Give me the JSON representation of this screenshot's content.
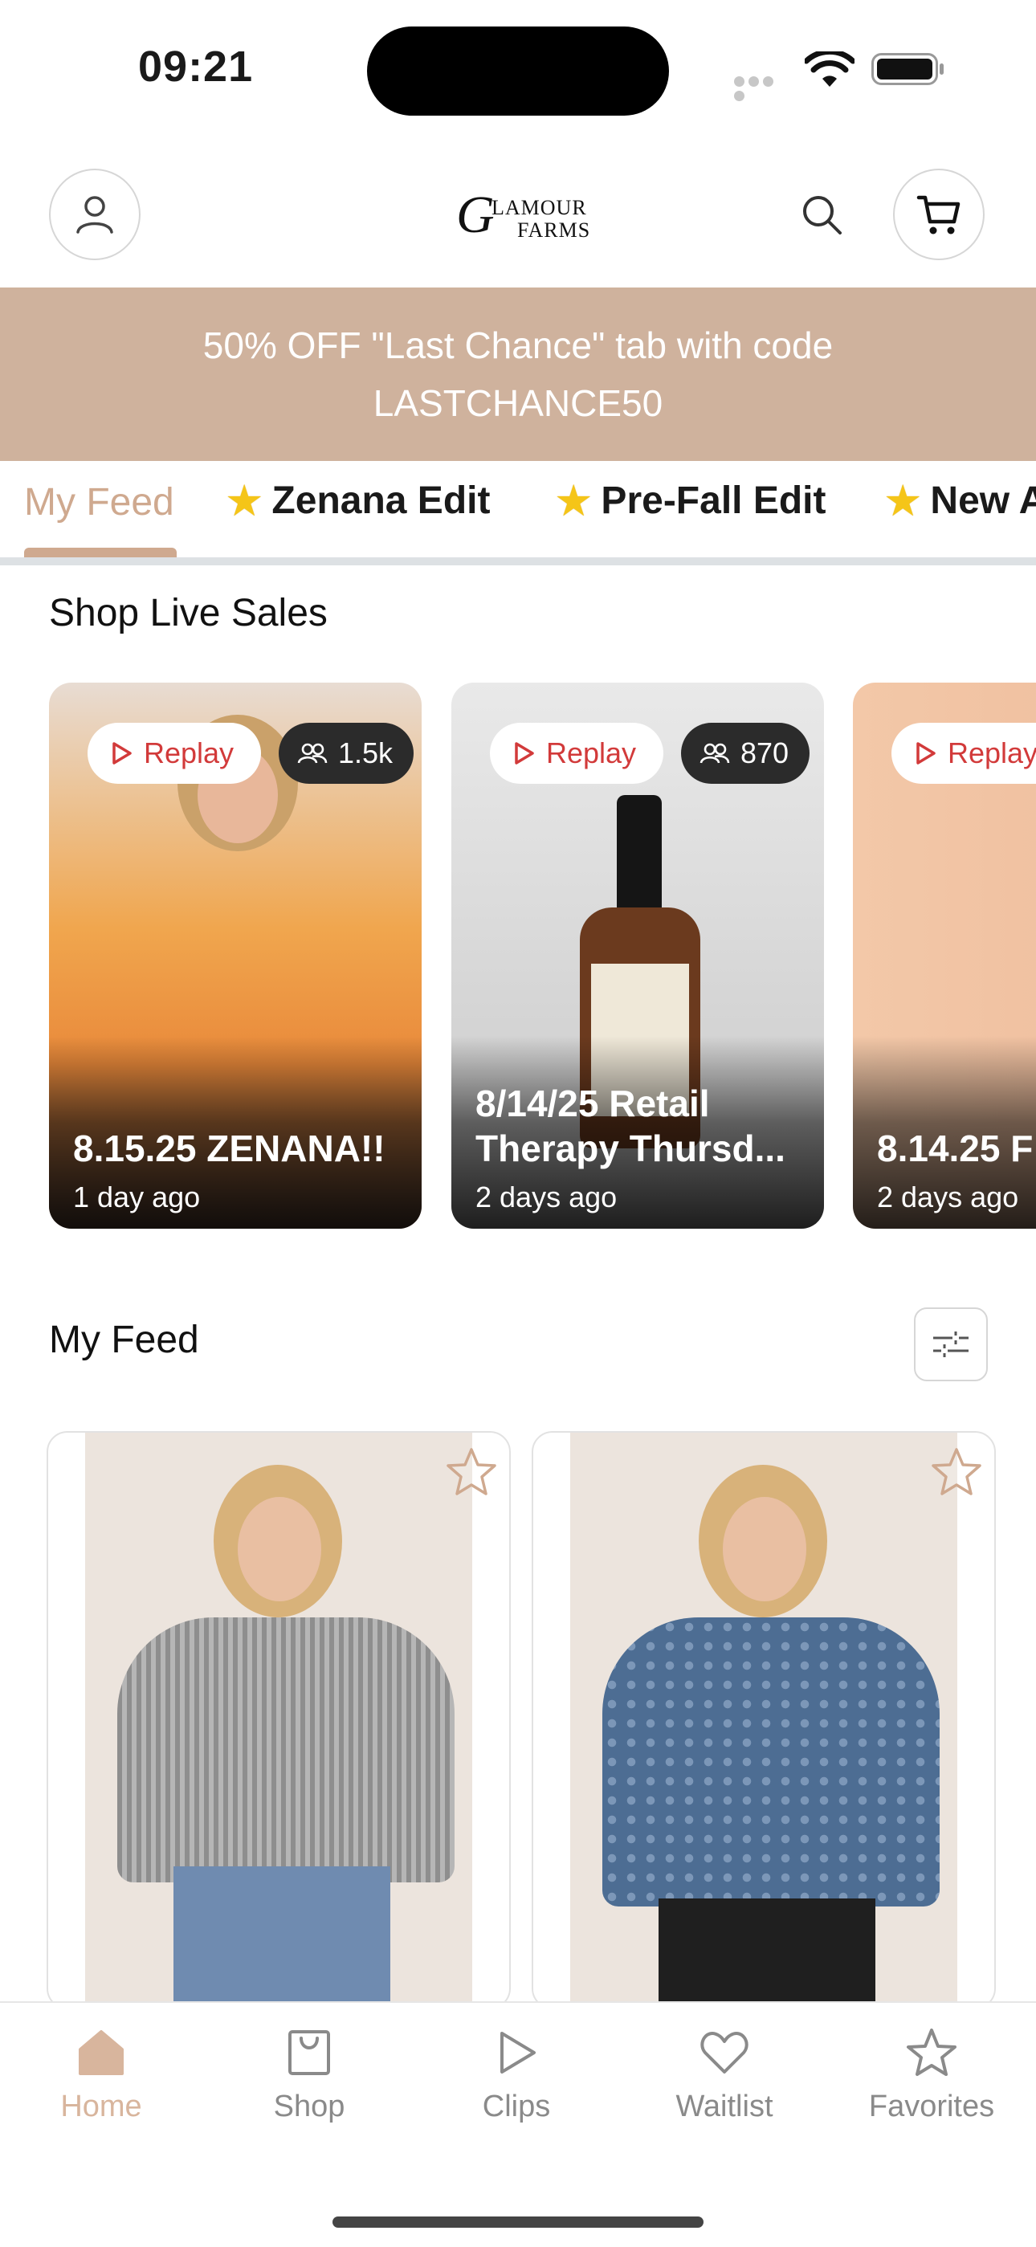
{
  "status_bar": {
    "time": "09:21"
  },
  "header": {
    "logo_initial": "G",
    "logo_line1": "LAMOUR",
    "logo_line2": "FARMS"
  },
  "promo": {
    "text": "50% OFF \"Last Chance\" tab with code LASTCHANCE50"
  },
  "tabs": [
    {
      "label": "My Feed",
      "active": true
    },
    {
      "label": "Zenana Edit",
      "active": false
    },
    {
      "label": "Pre-Fall Edit",
      "active": false
    },
    {
      "label": "New A",
      "active": false
    }
  ],
  "live_sales": {
    "title": "Shop Live Sales",
    "cards": [
      {
        "badge": "Replay",
        "viewers": "1.5k",
        "title": "8.15.25 ZENANA!!",
        "time": "1 day ago"
      },
      {
        "badge": "Replay",
        "viewers": "870",
        "title": "8/14/25 Retail Therapy Thursd...",
        "time": "2 days ago"
      },
      {
        "badge": "Replay",
        "viewers": "",
        "title": "8.14.25 F",
        "time": "2 days ago"
      }
    ]
  },
  "feed": {
    "title": "My Feed"
  },
  "bottom_nav": [
    {
      "label": "Home",
      "active": true
    },
    {
      "label": "Shop",
      "active": false
    },
    {
      "label": "Clips",
      "active": false
    },
    {
      "label": "Waitlist",
      "active": false
    },
    {
      "label": "Favorites",
      "active": false
    }
  ],
  "colors": {
    "accent": "#cfa98f",
    "banner": "#cfb29d",
    "replay_red": "#d23a3a"
  }
}
